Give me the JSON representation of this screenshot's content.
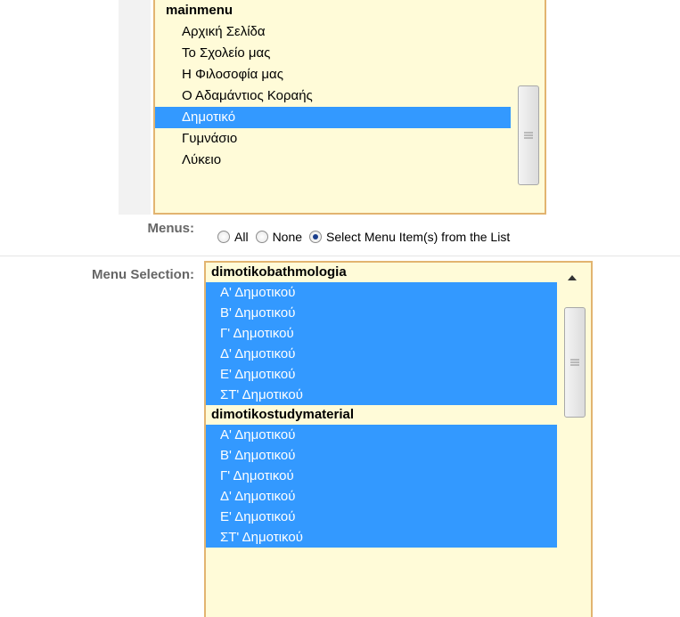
{
  "top_list": {
    "group": "mainmenu",
    "items": [
      {
        "label": "Αρχική Σελίδα",
        "selected": false
      },
      {
        "label": "Το Σχολείο μας",
        "selected": false
      },
      {
        "label": "Η Φιλοσοφία μας",
        "selected": false
      },
      {
        "label": "Ο Αδαμάντιος Κοραής",
        "selected": false
      },
      {
        "label": "Δημοτικό",
        "selected": true
      },
      {
        "label": "Γυμνάσιο",
        "selected": false
      },
      {
        "label": "Λύκειο",
        "selected": false
      }
    ]
  },
  "menus": {
    "label": "Menus:",
    "options": [
      {
        "label": "All",
        "checked": false
      },
      {
        "label": "None",
        "checked": false
      },
      {
        "label": "Select Menu Item(s) from the List",
        "checked": true
      }
    ]
  },
  "menu_selection": {
    "label": "Menu Selection:",
    "groups": [
      {
        "name": "dimotikobathmologia",
        "items": [
          "Α' Δημοτικού",
          "Β' Δημοτικού",
          "Γ' Δημοτικού",
          "Δ' Δημοτικού",
          "Ε' Δημοτικού",
          "ΣΤ' Δημοτικού"
        ]
      },
      {
        "name": "dimotikostudymaterial",
        "items": [
          "Α' Δημοτικού",
          "Β' Δημοτικού",
          "Γ' Δημοτικού",
          "Δ' Δημοτικού",
          "Ε' Δημοτικού",
          "ΣΤ' Δημοτικού"
        ]
      }
    ]
  },
  "colors": {
    "selection": "#3399ff",
    "listbox_bg": "#fffbd8",
    "listbox_border": "#e2b470",
    "label_gray": "#666666"
  }
}
